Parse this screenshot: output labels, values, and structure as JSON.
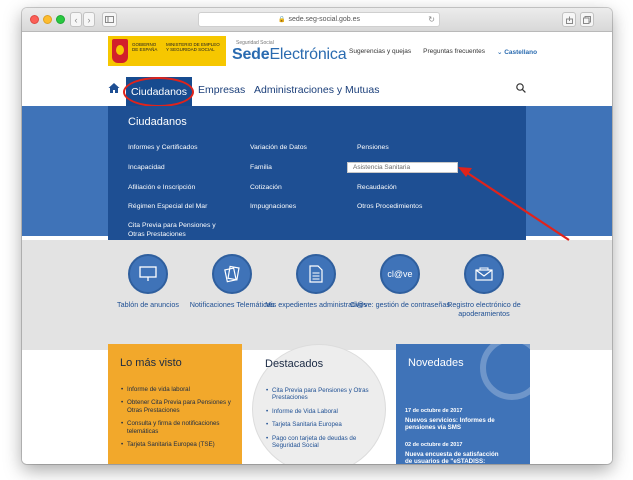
{
  "browser": {
    "url": "sede.seg-social.gob.es",
    "tab_icon": "sidebar-icon",
    "share_icon": "share-icon",
    "tabs_icon": "tabs-icon"
  },
  "header": {
    "gov_line1": "GOBIERNO DE ESPAÑA",
    "ministry": "MINISTERIO DE EMPLEO Y SEGURIDAD SOCIAL",
    "sede_sub": "Seguridad Social",
    "sede_bold": "Sede",
    "sede_light": "Electrónica",
    "links": {
      "suggestions": "Sugerencias y quejas",
      "faq": "Preguntas frecuentes",
      "lang": "Castellano"
    }
  },
  "nav": {
    "items": [
      "Ciudadanos",
      "Empresas",
      "Administraciones y Mutuas"
    ]
  },
  "dropdown": {
    "title": "Ciudadanos",
    "col1": [
      "Informes y Certificados",
      "Incapacidad",
      "Afiliación e Inscripción",
      "Régimen Especial del Mar",
      "Cita Previa para Pensiones y Otras Prestaciones"
    ],
    "col2": [
      "Variación de Datos",
      "Familia",
      "Cotización",
      "Impugnaciones"
    ],
    "col3": [
      "Pensiones",
      "Asistencia Sanitaria",
      "Recaudación",
      "Otros Procedimientos"
    ]
  },
  "services": [
    {
      "label": "Tablón de anuncios",
      "icon": "board-icon"
    },
    {
      "label": "Notificaciones Telemáticas",
      "icon": "documents-icon"
    },
    {
      "label": "Mis expedientes administrativos",
      "icon": "file-icon"
    },
    {
      "label": "Cl@ve: gestión de contraseñas",
      "icon": "clave-icon"
    },
    {
      "label": "Registro electrónico de apoderamientos",
      "icon": "envelope-icon"
    }
  ],
  "cards": {
    "most_viewed": {
      "title": "Lo más visto",
      "items": [
        "Informe de vida laboral",
        "Obtener Cita Previa para Pensiones y Otras Prestaciones",
        "Consulta y firma de notificaciones telemáticas",
        "Tarjeta Sanitaria Europea (TSE)"
      ]
    },
    "featured": {
      "title": "Destacados",
      "items": [
        "Cita Previa para Pensiones y Otras Prestaciones",
        "Informe de Vida Laboral",
        "Tarjeta Sanitaria Europea",
        "Pago con tarjeta de deudas de Seguridad Social"
      ]
    },
    "news": {
      "title": "Novedades",
      "items": [
        {
          "date": "17 de octubre de 2017",
          "text": "Nuevos servicios: Informes de pensiones vía SMS"
        },
        {
          "date": "02 de octubre de 2017",
          "text": "Nueva encuesta de satisfacción de usuarios de \"eSTADISS: Estadísticas de pensiones\""
        }
      ]
    }
  },
  "colors": {
    "primary_blue": "#1e4f93",
    "band_blue": "#3f73b8",
    "orange": "#f2a82b",
    "annotation_red": "#e0231b"
  }
}
